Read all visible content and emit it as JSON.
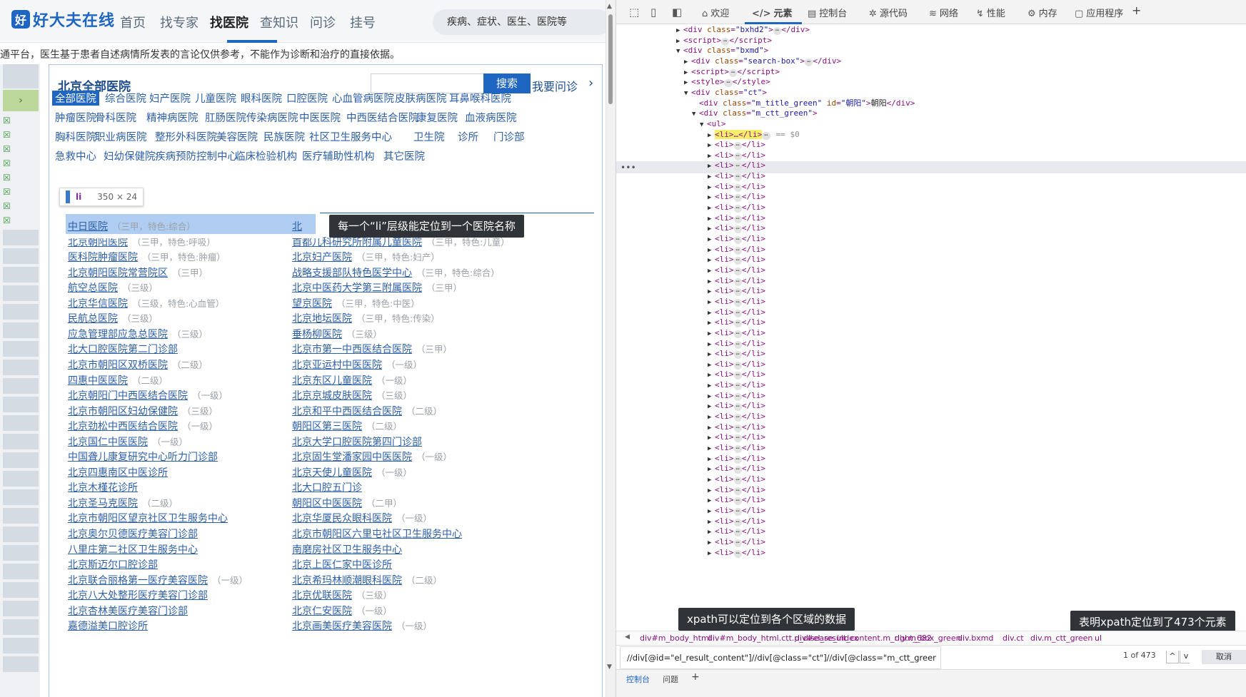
{
  "site": {
    "logo_mark": "好",
    "logo_text": "好大夫在线",
    "nav": [
      "首页",
      "找专家",
      "找医院",
      "查知识",
      "问诊",
      "挂号"
    ],
    "search_placeholder": "疾病、症状、医生、医院等",
    "notice": "通平台，医生基于患者自述病情所发表的言论仅供参考，不能作为诊断和治疗的直接依据。"
  },
  "panel": {
    "title": "北京全部医院",
    "search_button": "搜索",
    "ask_link": "我要问诊",
    "ask_arrow": "›",
    "categories": [
      [
        "全部医院",
        "综合医院",
        "妇产医院",
        "儿童医院",
        "眼科医院",
        "口腔医院",
        "心血管病医院",
        "皮肤病医院",
        "耳鼻喉科医院"
      ],
      [
        "肿瘤医院",
        "骨科医院",
        "精神病医院",
        "肛肠医院",
        "传染病医院",
        "中医医院",
        "中西医结合医院",
        "康复医院",
        "血液病医院"
      ],
      [
        "胸科医院",
        "职业病医院",
        "整形外科医院",
        "美容医院",
        "民族医院",
        "社区卫生服务中心",
        "卫生院",
        "诊所",
        "门诊部"
      ],
      [
        "急救中心",
        "妇幼保健院",
        "疾病预防控制中心",
        "临床检验机构",
        "医疗辅助性机构",
        "其它医院"
      ]
    ],
    "inspect_badge": {
      "tag": "li",
      "dims": "350 × 24"
    },
    "tooltip": "每一个“li”层级能定位到一个医院名称",
    "hospitals_left": [
      {
        "name": "中日医院",
        "level": "（三甲，特色:综合）"
      },
      {
        "name": "北京朝阳医院",
        "level": "（三甲，特色:呼吸）"
      },
      {
        "name": "医科院肿瘤医院",
        "level": "（三甲，特色:肿瘤）"
      },
      {
        "name": "北京朝阳医院常营院区",
        "level": "（三甲）"
      },
      {
        "name": "航空总医院",
        "level": "（三级）"
      },
      {
        "name": "北京华信医院",
        "level": "（三级，特色:心血管）"
      },
      {
        "name": "民航总医院",
        "level": "（三级）"
      },
      {
        "name": "应急管理部应急总医院",
        "level": "（三级）"
      },
      {
        "name": "北大口腔医院第二门诊部",
        "level": ""
      },
      {
        "name": "北京市朝阳区双桥医院",
        "level": "（二级）"
      },
      {
        "name": "四惠中医医院",
        "level": "（二级）"
      },
      {
        "name": "北京朝阳门中西医结合医院",
        "level": "（一级）"
      },
      {
        "name": "北京市朝阳区妇幼保健院",
        "level": "（三级）"
      },
      {
        "name": "北京劲松中西医结合医院",
        "level": "（一级）"
      },
      {
        "name": "北京国仁中医医院",
        "level": "（一级）"
      },
      {
        "name": "中国聋儿康复研究中心听力门诊部",
        "level": ""
      },
      {
        "name": "北京四惠南区中医诊所",
        "level": ""
      },
      {
        "name": "北京木槿花诊所",
        "level": ""
      },
      {
        "name": "北京圣马克医院",
        "level": "（二级）"
      },
      {
        "name": "北京市朝阳区望京社区卫生服务中心",
        "level": ""
      },
      {
        "name": "北京奥尔贝德医疗美容门诊部",
        "level": ""
      },
      {
        "name": "八里庄第二社区卫生服务中心",
        "level": ""
      },
      {
        "name": "北京斯迈尔口腔诊部",
        "level": ""
      },
      {
        "name": "北京联合丽格第一医疗美容医院",
        "level": "（一级）"
      },
      {
        "name": "北京八大处整形医疗美容门诊部",
        "level": ""
      },
      {
        "name": "北京杏林美医疗美容门诊部",
        "level": ""
      },
      {
        "name": "嘉德溢美口腔诊所",
        "level": ""
      }
    ],
    "hospitals_right": [
      {
        "name": "北",
        "level": ""
      },
      {
        "name": "首都儿科研究所附属儿童医院",
        "level": "（三甲，特色:儿童）"
      },
      {
        "name": "北京妇产医院",
        "level": "（三甲，特色:妇产）"
      },
      {
        "name": "战略支援部队特色医学中心",
        "level": "（三甲，特色:综合）"
      },
      {
        "name": "北京中医药大学第三附属医院",
        "level": "（三甲）"
      },
      {
        "name": "望京医院",
        "level": "（三甲，特色:中医）"
      },
      {
        "name": "北京地坛医院",
        "level": "（三甲，特色:传染）"
      },
      {
        "name": "垂杨柳医院",
        "level": "（三级）"
      },
      {
        "name": "北京市第一中西医结合医院",
        "level": "（三甲）"
      },
      {
        "name": "北京亚运村中医医院",
        "level": "（一级）"
      },
      {
        "name": "北京东区儿童医院",
        "level": "（一级）"
      },
      {
        "name": "北京京城皮肤医院",
        "level": "（三级）"
      },
      {
        "name": "北京和平中西医结合医院",
        "level": "（二级）"
      },
      {
        "name": "朝阳区第三医院",
        "level": "（二级）"
      },
      {
        "name": "北京大学口腔医院第四门诊部",
        "level": ""
      },
      {
        "name": "北京固生堂潘家园中医医院",
        "level": "（一级）"
      },
      {
        "name": "北京天使儿童医院",
        "level": "（一级）"
      },
      {
        "name": "北大口腔五门诊",
        "level": ""
      },
      {
        "name": "朝阳区中医医院",
        "level": "（二甲）"
      },
      {
        "name": "北京华厦民众眼科医院",
        "level": "（一级）"
      },
      {
        "name": "北京市朝阳区六里屯社区卫生服务中心",
        "level": ""
      },
      {
        "name": "南磨房社区卫生服务中心",
        "level": ""
      },
      {
        "name": "北京上医仁家中医诊所",
        "level": ""
      },
      {
        "name": "北京希玛林顺潮眼科医院",
        "level": "（二级）"
      },
      {
        "name": "北京优联医院",
        "level": "（三级）"
      },
      {
        "name": "北京仁安医院",
        "level": "（一级）"
      },
      {
        "name": "北京画美医疗美容医院",
        "level": "（一级）"
      }
    ]
  },
  "devtools": {
    "tabs": [
      {
        "label": "欢迎",
        "icon": "⌂"
      },
      {
        "label": "元素",
        "icon": "</>"
      },
      {
        "label": "控制台",
        "icon": "▤"
      },
      {
        "label": "源代码",
        "icon": "✲"
      },
      {
        "label": "网络",
        "icon": "≋"
      },
      {
        "label": "性能",
        "icon": "↯"
      },
      {
        "label": "内存",
        "icon": "⚙"
      },
      {
        "label": "应用程序",
        "icon": "▢"
      }
    ],
    "add_tab": "+",
    "dom_lines": [
      {
        "indent": 0,
        "tri": "▶",
        "html": "<span>&lt;div </span><span class=\"attr\">class</span>=<span class=\"val\">\"bxhd2\"</span>&gt;<span class=\"dots\">⋯</span>&lt;/div&gt;"
      },
      {
        "indent": 0,
        "tri": "▶",
        "html": "&lt;script&gt;<span class=\"dots\">⋯</span>&lt;/script&gt;"
      },
      {
        "indent": 0,
        "tri": "▼",
        "html": "&lt;div <span class=\"attr\">class</span>=<span class=\"val\">\"bxmd\"</span>&gt;"
      },
      {
        "indent": 1,
        "tri": "▶",
        "html": "&lt;div <span class=\"attr\">class</span>=<span class=\"val\">\"search-box\"</span>&gt;<span class=\"dots\">⋯</span>&lt;/div&gt;"
      },
      {
        "indent": 1,
        "tri": "▶",
        "html": "&lt;script&gt;<span class=\"dots\">⋯</span>&lt;/script&gt;"
      },
      {
        "indent": 1,
        "tri": "▶",
        "html": "&lt;style&gt;<span class=\"dots\">⋯</span>&lt;/style&gt;"
      },
      {
        "indent": 1,
        "tri": "▼",
        "html": "&lt;div <span class=\"attr\">class</span>=<span class=\"val\">\"ct\"</span>&gt;"
      },
      {
        "indent": 2,
        "tri": "",
        "html": "&lt;div <span class=\"attr\">class</span>=<span class=\"val\">\"m_title_green\"</span> <span class=\"attr\">id</span>=<span class=\"val\">\"朝阳\"</span>&gt;<span class=\"txt\">朝阳</span>&lt;/div&gt;"
      },
      {
        "indent": 2,
        "tri": "▼",
        "html": "&lt;div <span class=\"attr\">class</span>=<span class=\"val\">\"m_ctt_green\"</span>&gt;"
      },
      {
        "indent": 3,
        "tri": "▼",
        "html": "&lt;ul&gt;"
      }
    ],
    "selected_li": "<li>…</li>",
    "selected_suffix": "== $0",
    "li_line": "<li> ⋯ </li>",
    "li_count": 40,
    "tooltip_xpath": "xpath可以定位到各个区域的数据",
    "tooltip_count": "表明xpath定位到了473个元素",
    "breadcrumbs": [
      "div#m_body_html",
      "div#m_body_html.ctt.p_disease_index",
      "div#el_result_content.m_right_682",
      "div.m_box_green",
      "div.bxmd",
      "div.ct",
      "div.m_ctt_green",
      "ul"
    ],
    "xpath_query": "//div[@id=\"el_result_content\"]//div[@class=\"ct\"]//div[@class=\"m_ctt_green\"]//li",
    "match_count": "1 of 473",
    "prev_label": "^",
    "next_label": "v",
    "cancel_label": "取消",
    "drawer_tabs": [
      "控制台",
      "问题"
    ],
    "drawer_add": "+"
  }
}
